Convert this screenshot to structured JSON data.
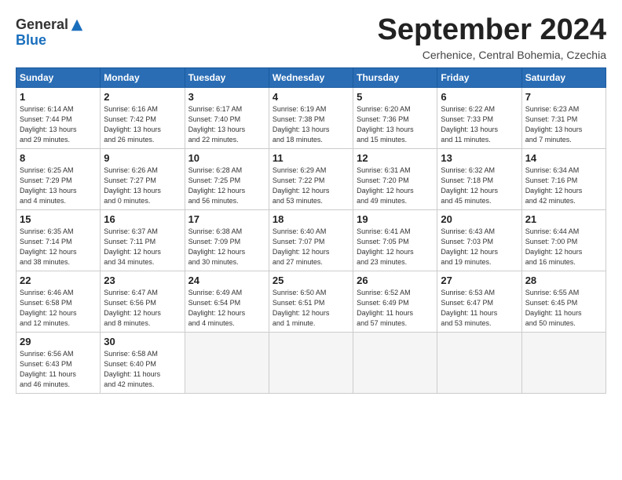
{
  "logo": {
    "general": "General",
    "blue": "Blue"
  },
  "title": "September 2024",
  "location": "Cerhenice, Central Bohemia, Czechia",
  "days_header": [
    "Sunday",
    "Monday",
    "Tuesday",
    "Wednesday",
    "Thursday",
    "Friday",
    "Saturday"
  ],
  "weeks": [
    [
      {
        "day": "1",
        "detail": "Sunrise: 6:14 AM\nSunset: 7:44 PM\nDaylight: 13 hours\nand 29 minutes."
      },
      {
        "day": "2",
        "detail": "Sunrise: 6:16 AM\nSunset: 7:42 PM\nDaylight: 13 hours\nand 26 minutes."
      },
      {
        "day": "3",
        "detail": "Sunrise: 6:17 AM\nSunset: 7:40 PM\nDaylight: 13 hours\nand 22 minutes."
      },
      {
        "day": "4",
        "detail": "Sunrise: 6:19 AM\nSunset: 7:38 PM\nDaylight: 13 hours\nand 18 minutes."
      },
      {
        "day": "5",
        "detail": "Sunrise: 6:20 AM\nSunset: 7:36 PM\nDaylight: 13 hours\nand 15 minutes."
      },
      {
        "day": "6",
        "detail": "Sunrise: 6:22 AM\nSunset: 7:33 PM\nDaylight: 13 hours\nand 11 minutes."
      },
      {
        "day": "7",
        "detail": "Sunrise: 6:23 AM\nSunset: 7:31 PM\nDaylight: 13 hours\nand 7 minutes."
      }
    ],
    [
      {
        "day": "8",
        "detail": "Sunrise: 6:25 AM\nSunset: 7:29 PM\nDaylight: 13 hours\nand 4 minutes."
      },
      {
        "day": "9",
        "detail": "Sunrise: 6:26 AM\nSunset: 7:27 PM\nDaylight: 13 hours\nand 0 minutes."
      },
      {
        "day": "10",
        "detail": "Sunrise: 6:28 AM\nSunset: 7:25 PM\nDaylight: 12 hours\nand 56 minutes."
      },
      {
        "day": "11",
        "detail": "Sunrise: 6:29 AM\nSunset: 7:22 PM\nDaylight: 12 hours\nand 53 minutes."
      },
      {
        "day": "12",
        "detail": "Sunrise: 6:31 AM\nSunset: 7:20 PM\nDaylight: 12 hours\nand 49 minutes."
      },
      {
        "day": "13",
        "detail": "Sunrise: 6:32 AM\nSunset: 7:18 PM\nDaylight: 12 hours\nand 45 minutes."
      },
      {
        "day": "14",
        "detail": "Sunrise: 6:34 AM\nSunset: 7:16 PM\nDaylight: 12 hours\nand 42 minutes."
      }
    ],
    [
      {
        "day": "15",
        "detail": "Sunrise: 6:35 AM\nSunset: 7:14 PM\nDaylight: 12 hours\nand 38 minutes."
      },
      {
        "day": "16",
        "detail": "Sunrise: 6:37 AM\nSunset: 7:11 PM\nDaylight: 12 hours\nand 34 minutes."
      },
      {
        "day": "17",
        "detail": "Sunrise: 6:38 AM\nSunset: 7:09 PM\nDaylight: 12 hours\nand 30 minutes."
      },
      {
        "day": "18",
        "detail": "Sunrise: 6:40 AM\nSunset: 7:07 PM\nDaylight: 12 hours\nand 27 minutes."
      },
      {
        "day": "19",
        "detail": "Sunrise: 6:41 AM\nSunset: 7:05 PM\nDaylight: 12 hours\nand 23 minutes."
      },
      {
        "day": "20",
        "detail": "Sunrise: 6:43 AM\nSunset: 7:03 PM\nDaylight: 12 hours\nand 19 minutes."
      },
      {
        "day": "21",
        "detail": "Sunrise: 6:44 AM\nSunset: 7:00 PM\nDaylight: 12 hours\nand 16 minutes."
      }
    ],
    [
      {
        "day": "22",
        "detail": "Sunrise: 6:46 AM\nSunset: 6:58 PM\nDaylight: 12 hours\nand 12 minutes."
      },
      {
        "day": "23",
        "detail": "Sunrise: 6:47 AM\nSunset: 6:56 PM\nDaylight: 12 hours\nand 8 minutes."
      },
      {
        "day": "24",
        "detail": "Sunrise: 6:49 AM\nSunset: 6:54 PM\nDaylight: 12 hours\nand 4 minutes."
      },
      {
        "day": "25",
        "detail": "Sunrise: 6:50 AM\nSunset: 6:51 PM\nDaylight: 12 hours\nand 1 minute."
      },
      {
        "day": "26",
        "detail": "Sunrise: 6:52 AM\nSunset: 6:49 PM\nDaylight: 11 hours\nand 57 minutes."
      },
      {
        "day": "27",
        "detail": "Sunrise: 6:53 AM\nSunset: 6:47 PM\nDaylight: 11 hours\nand 53 minutes."
      },
      {
        "day": "28",
        "detail": "Sunrise: 6:55 AM\nSunset: 6:45 PM\nDaylight: 11 hours\nand 50 minutes."
      }
    ],
    [
      {
        "day": "29",
        "detail": "Sunrise: 6:56 AM\nSunset: 6:43 PM\nDaylight: 11 hours\nand 46 minutes."
      },
      {
        "day": "30",
        "detail": "Sunrise: 6:58 AM\nSunset: 6:40 PM\nDaylight: 11 hours\nand 42 minutes."
      },
      {
        "day": "",
        "detail": ""
      },
      {
        "day": "",
        "detail": ""
      },
      {
        "day": "",
        "detail": ""
      },
      {
        "day": "",
        "detail": ""
      },
      {
        "day": "",
        "detail": ""
      }
    ]
  ]
}
